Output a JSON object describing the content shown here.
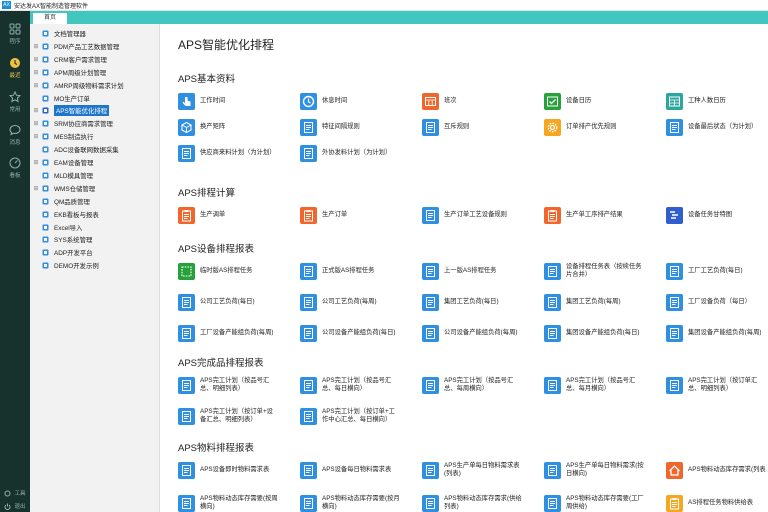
{
  "app": {
    "logo": "AX",
    "title": "安达发AX智能制造管理软件"
  },
  "rail": {
    "items": [
      {
        "label": "程序",
        "icon": "grid-icon"
      },
      {
        "label": "最近",
        "icon": "clock-icon"
      },
      {
        "label": "常用",
        "icon": "star-icon"
      },
      {
        "label": "消息",
        "icon": "chat-icon"
      },
      {
        "label": "看板",
        "icon": "dashboard-icon"
      }
    ],
    "tools_label": "工具",
    "logout_label": "退出"
  },
  "tabs": [
    {
      "label": "首页"
    }
  ],
  "tree": {
    "items": [
      {
        "label": "文档管理器",
        "expander": ""
      },
      {
        "label": "PDM产品工艺数据管理",
        "expander": "⊞"
      },
      {
        "label": "CRM客户需求管理",
        "expander": "⊞"
      },
      {
        "label": "APM周级计划管理",
        "expander": "⊞"
      },
      {
        "label": "AMRP周级物料需求计划",
        "expander": "⊞"
      },
      {
        "label": "MO生产订单",
        "expander": ""
      },
      {
        "label": "APS智能优化排程",
        "expander": "⊞"
      },
      {
        "label": "SRM协应商需求管理",
        "expander": "⊞"
      },
      {
        "label": "MES制造执行",
        "expander": "⊞"
      },
      {
        "label": "ADC设备联网数据采集",
        "expander": ""
      },
      {
        "label": "EAM设备管理",
        "expander": "⊞"
      },
      {
        "label": "MLD模具管理",
        "expander": ""
      },
      {
        "label": "WMS仓储管理",
        "expander": "⊞"
      },
      {
        "label": "QM品质管理",
        "expander": ""
      },
      {
        "label": "EKB看板与报表",
        "expander": ""
      },
      {
        "label": "Excel导入",
        "expander": ""
      },
      {
        "label": "SYS系统管理",
        "expander": ""
      },
      {
        "label": "ADP开发平台",
        "expander": ""
      },
      {
        "label": "DEMO开发示例",
        "expander": ""
      }
    ]
  },
  "main": {
    "title": "APS智能优化排程",
    "sections": [
      {
        "title": "APS基本资料",
        "items": [
          {
            "l1": "工作时间",
            "l2": "",
            "icon": "hand-pointer-icon",
            "color": "#2f8fe0"
          },
          {
            "l1": "休息时间",
            "l2": "",
            "icon": "clock-icon",
            "color": "#2f8fe0"
          },
          {
            "l1": "班次",
            "l2": "",
            "icon": "calendar-grid-icon",
            "color": "#f0672e"
          },
          {
            "l1": "设备日历",
            "l2": "",
            "icon": "calendar-check-icon",
            "color": "#27a23a"
          },
          {
            "l1": "工种人数日历",
            "l2": "",
            "icon": "calendar-table-icon",
            "color": "#2aa89f"
          },
          {
            "l1": "换产矩阵",
            "l2": "",
            "icon": "cube-icon",
            "color": "#2f8fe0"
          },
          {
            "l1": "特征间隔规则",
            "l2": "",
            "icon": "document-icon",
            "color": "#2f8fe0"
          },
          {
            "l1": "互斥规则",
            "l2": "",
            "icon": "document-icon",
            "color": "#2f8fe0"
          },
          {
            "l1": "订单排产优先规则",
            "l2": "",
            "icon": "gear-icon",
            "color": "#f5a623"
          },
          {
            "l1": "设备最后状态（为计划）",
            "l2": "",
            "icon": "document-icon",
            "color": "#2f8fe0"
          },
          {
            "l1": "供应商来料计划（为计划）",
            "l2": "",
            "icon": "document-icon",
            "color": "#2f8fe0"
          },
          {
            "l1": "外协发料计划（为计划）",
            "l2": "",
            "icon": "document-icon",
            "color": "#2f8fe0"
          }
        ]
      },
      {
        "title": "APS排程计算",
        "items": [
          {
            "l1": "生产调单",
            "l2": "",
            "icon": "clipboard-icon",
            "color": "#f0672e"
          },
          {
            "l1": "生产订单",
            "l2": "",
            "icon": "clipboard-icon",
            "color": "#f0672e"
          },
          {
            "l1": "生产订单工艺设备规则",
            "l2": "",
            "icon": "document-icon",
            "color": "#2f8fe0"
          },
          {
            "l1": "生产单工序排产结果",
            "l2": "",
            "icon": "clipboard-icon",
            "color": "#f0672e"
          },
          {
            "l1": "设备任务甘特图",
            "l2": "",
            "icon": "gantt-icon",
            "color": "#2f5fcf"
          }
        ]
      },
      {
        "title": "APS设备排程报表",
        "items": [
          {
            "l1": "临时版AS排程任务",
            "l2": "",
            "icon": "dashed-square-icon",
            "color": "#27a23a"
          },
          {
            "l1": "正式版AS排程任务",
            "l2": "",
            "icon": "document-icon",
            "color": "#2f8fe0"
          },
          {
            "l1": "上一版AS排程任务",
            "l2": "",
            "icon": "document-icon",
            "color": "#2f8fe0"
          },
          {
            "l1": "设备排程任务表（按续任务",
            "l2": "片合并）",
            "icon": "document-icon",
            "color": "#2f8fe0"
          },
          {
            "l1": "工厂工艺负荷(每日)",
            "l2": "",
            "icon": "document-icon",
            "color": "#2f8fe0"
          },
          {
            "l1": "公司工艺负荷(每日)",
            "l2": "",
            "icon": "document-icon",
            "color": "#2f8fe0"
          },
          {
            "l1": "公司工艺负荷(每周)",
            "l2": "",
            "icon": "document-icon",
            "color": "#2f8fe0"
          },
          {
            "l1": "集团工艺负荷(每日)",
            "l2": "",
            "icon": "document-icon",
            "color": "#2f8fe0"
          },
          {
            "l1": "集团工艺负荷(每周)",
            "l2": "",
            "icon": "document-icon",
            "color": "#2f8fe0"
          },
          {
            "l1": "工厂设备负荷（每日）",
            "l2": "",
            "icon": "document-icon",
            "color": "#2f8fe0"
          },
          {
            "l1": "工厂设备产能组负荷(每周)",
            "l2": "",
            "icon": "document-icon",
            "color": "#2f8fe0"
          },
          {
            "l1": "公司设备产能组负荷(每日)",
            "l2": "",
            "icon": "document-icon",
            "color": "#2f8fe0"
          },
          {
            "l1": "公司设备产能组负荷(每周)",
            "l2": "",
            "icon": "document-icon",
            "color": "#2f8fe0"
          },
          {
            "l1": "集团设备产能组负荷(每日)",
            "l2": "",
            "icon": "document-icon",
            "color": "#2f8fe0"
          },
          {
            "l1": "集团设备产能组负荷(每周)",
            "l2": "",
            "icon": "document-icon",
            "color": "#2f8fe0"
          }
        ]
      },
      {
        "title": "APS完成品排程报表",
        "items": [
          {
            "l1": "APS完工计划（按品号汇",
            "l2": "总、明细列表）",
            "icon": "document-icon",
            "color": "#2f8fe0"
          },
          {
            "l1": "APS完工计划（按品号汇",
            "l2": "总、每日横向）",
            "icon": "document-icon",
            "color": "#2f8fe0"
          },
          {
            "l1": "APS完工计划（按品号汇",
            "l2": "总、每周横向）",
            "icon": "document-icon",
            "color": "#2f8fe0"
          },
          {
            "l1": "APS完工计划（按品号汇",
            "l2": "总、每月横向）",
            "icon": "document-icon",
            "color": "#2f8fe0"
          },
          {
            "l1": "APS完工计划（按订单汇",
            "l2": "总、明细列表）",
            "icon": "document-icon",
            "color": "#2f8fe0"
          },
          {
            "l1": "APS完工计划（按订单+设",
            "l2": "备汇总、明细列表）",
            "icon": "document-icon",
            "color": "#2f8fe0"
          },
          {
            "l1": "APS完工计划（按订单+工",
            "l2": "作中心汇总、每日横向）",
            "icon": "document-icon",
            "color": "#2f8fe0"
          }
        ]
      },
      {
        "title": "APS物料排程报表",
        "items": [
          {
            "l1": "APS设备即时物料需求表",
            "l2": "",
            "icon": "document-icon",
            "color": "#2f8fe0"
          },
          {
            "l1": "APS设备每日物料需求表",
            "l2": "",
            "icon": "document-icon",
            "color": "#2f8fe0"
          },
          {
            "l1": "APS生产单每日物料需求表",
            "l2": "(列表)",
            "icon": "document-icon",
            "color": "#2f8fe0"
          },
          {
            "l1": "APS生产单每日物料需求(按",
            "l2": "日横向)",
            "icon": "document-icon",
            "color": "#2f8fe0"
          },
          {
            "l1": "APS物料动态库存需求(列表",
            "l2": "",
            "icon": "home-icon",
            "color": "#f0672e"
          },
          {
            "l1": "APS物料动态库存需要(按周",
            "l2": "横向)",
            "icon": "document-icon",
            "color": "#2f8fe0"
          },
          {
            "l1": "APS物料动态库存需要(按月",
            "l2": "横向)",
            "icon": "document-icon",
            "color": "#2f8fe0"
          },
          {
            "l1": "APS物料动态库存需求(供给",
            "l2": "列表)",
            "icon": "document-icon",
            "color": "#2f8fe0"
          },
          {
            "l1": "APS物料动态库存需要(工厂",
            "l2": "周供给)",
            "icon": "document-icon",
            "color": "#2f8fe0"
          },
          {
            "l1": "AS排程任务物料供给表",
            "l2": "",
            "icon": "clipboard-icon",
            "color": "#f5a623"
          }
        ]
      }
    ]
  }
}
